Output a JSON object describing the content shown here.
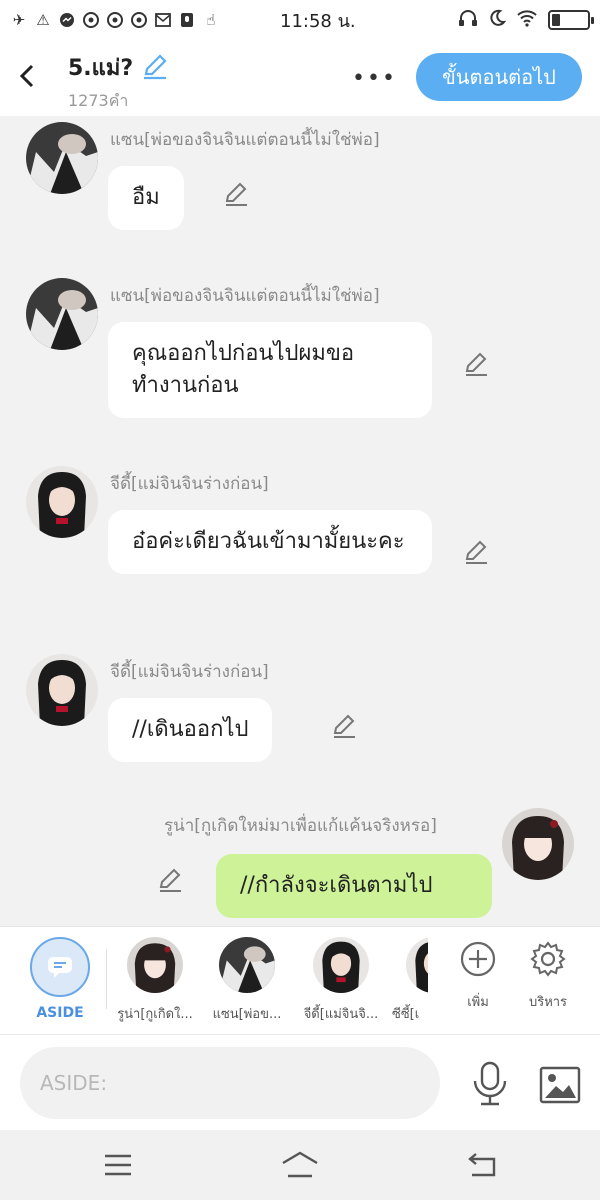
{
  "status_bar": {
    "time": "11:58 น.",
    "left_icons": [
      "airplane-icon",
      "warning-icon",
      "messenger-icon",
      "chrome-icon",
      "chrome-icon",
      "chrome-icon",
      "mail-icon",
      "voice-note-icon",
      "tap-icon"
    ],
    "right_icons": [
      "headphones-icon",
      "moon-icon",
      "wifi-icon",
      "battery-icon"
    ]
  },
  "header": {
    "title": "5.แม่?",
    "word_count": "1273คำ",
    "more_label": "•••",
    "next_button": "ขั้นตอนต่อไป"
  },
  "messages": [
    {
      "sender": "แซน[พ่อของจินจินแต่ตอนนี้ไม่ใช่พ่อ]",
      "text": "อืม",
      "side": "left",
      "avatar": "man"
    },
    {
      "sender": "แซน[พ่อของจินจินแต่ตอนนี้ไม่ใช่พ่อ]",
      "text": "คุณออกไปก่อนไปผมขอทำงานก่อน",
      "side": "left",
      "avatar": "man"
    },
    {
      "sender": "จีดี้[แม่จินจินร่างก่อน]",
      "text": "อ๋อค่ะเดียวฉันเข้ามามั้ยนะคะ",
      "side": "left",
      "avatar": "woman-dark"
    },
    {
      "sender": "จีดี้[แม่จินจินร่างก่อน]",
      "text": "//เดินออกไป",
      "side": "left",
      "avatar": "woman-dark"
    },
    {
      "sender": "รูน่า[กูเกิดใหม่มาเพื่อแก้แค้นจริงหรอ]",
      "text": "//กำลังจะเดินตามไป",
      "side": "right",
      "avatar": "woman-light"
    }
  ],
  "character_bar": {
    "aside_label": "ASIDE",
    "characters": [
      {
        "name": "รูน่า[กูเกิดใ...",
        "avatar": "woman-light"
      },
      {
        "name": "แซน[พ่อข...",
        "avatar": "man"
      },
      {
        "name": "จีดี้[แม่จินจิ...",
        "avatar": "woman-dark"
      },
      {
        "name": "ซีซี้[เ",
        "avatar": "woman-dark"
      }
    ],
    "add_label": "เพิ่ม",
    "manage_label": "บริหาร"
  },
  "input": {
    "placeholder": "ASIDE:"
  },
  "colors": {
    "accent": "#5aaef1",
    "my_bubble": "#cdf297",
    "background": "#f2f2f2"
  }
}
